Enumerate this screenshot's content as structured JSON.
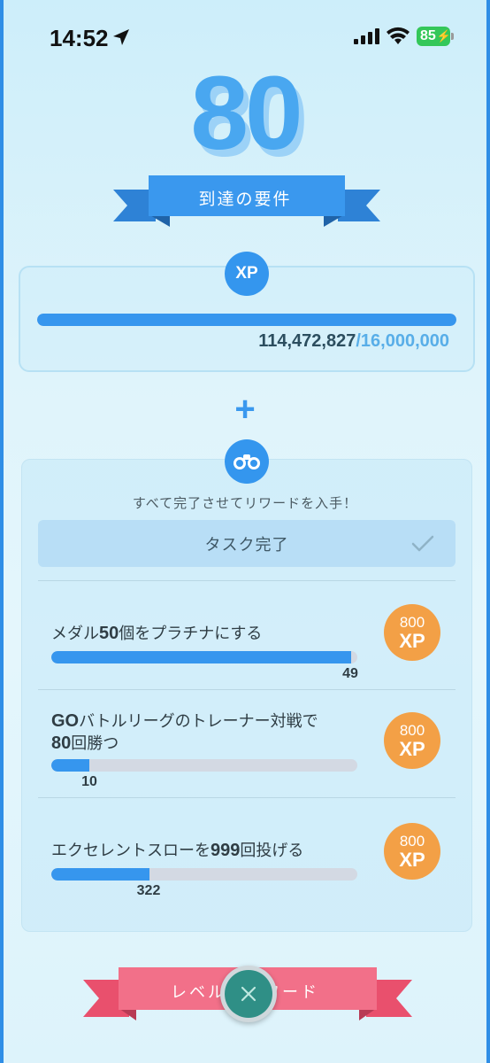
{
  "status_bar": {
    "time": "14:52",
    "battery": "85"
  },
  "level": {
    "number": "80",
    "title": "到達の要件"
  },
  "xp": {
    "icon_label": "XP",
    "current": "114,472,827",
    "separator": "/",
    "goal": "16,000,000",
    "progress_fraction": 1.0
  },
  "plus": "+",
  "tasks": {
    "instruction": "すべて完了させてリワードを入手！",
    "complete_button": "タスク完了",
    "items": [
      {
        "title_prefix": "メダル",
        "title_bold": "50",
        "title_suffix": "個をプラチナにする",
        "progress": "49",
        "fraction": 0.98,
        "reward_amount": "800",
        "reward_unit": "XP"
      },
      {
        "title_prefix": "",
        "title_bold": "GO",
        "title_suffix": "バトルリーグのトレーナー対戦で",
        "title_line2_bold": "80",
        "title_line2": "回勝つ",
        "progress": "10",
        "fraction": 0.125,
        "reward_amount": "800",
        "reward_unit": "XP"
      },
      {
        "title_prefix": "エクセレントスローを",
        "title_bold": "999",
        "title_suffix": "回投げる",
        "progress": "322",
        "fraction": 0.322,
        "reward_amount": "800",
        "reward_unit": "XP"
      }
    ]
  },
  "bottom": {
    "ribbon_label": "レベル　　ワード"
  },
  "colors": {
    "accent": "#3696ee",
    "reward": "#f3a046",
    "ribbon_pink": "#ef5f7a",
    "close": "#2f8f86"
  }
}
